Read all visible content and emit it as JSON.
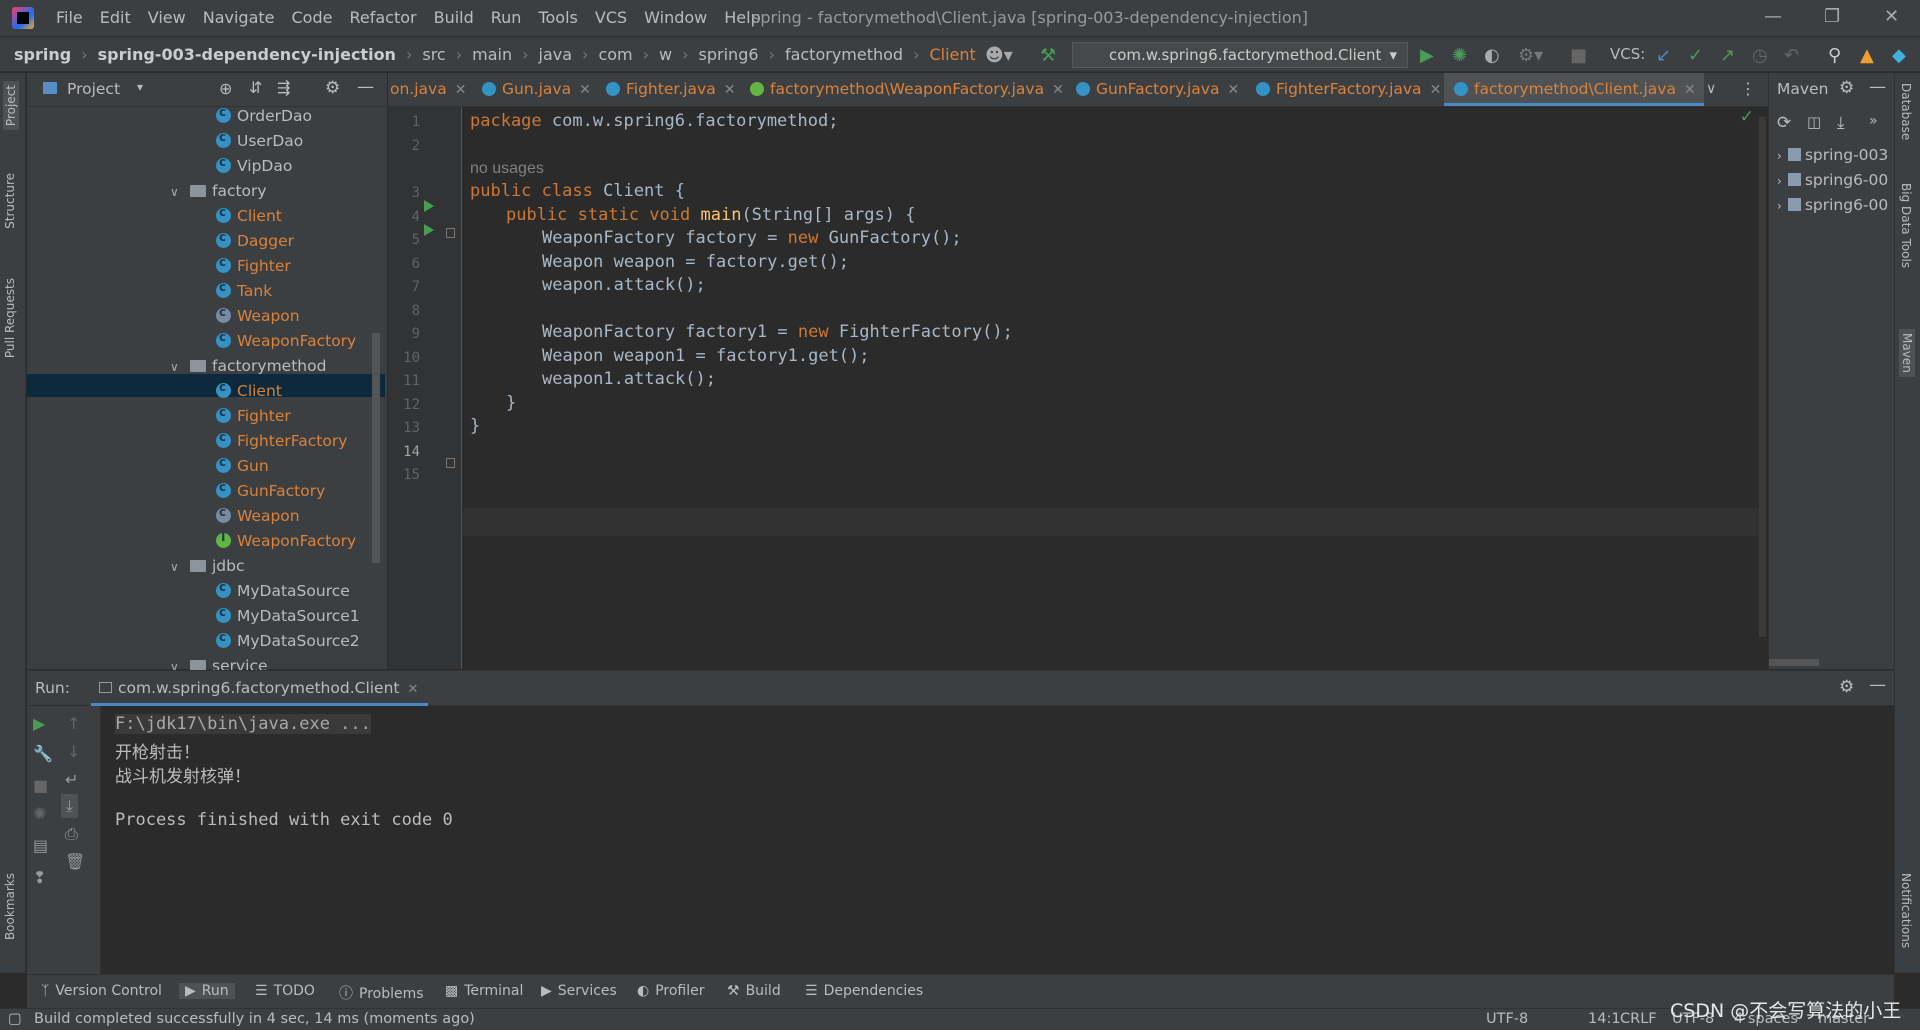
{
  "window": {
    "menu": [
      "File",
      "Edit",
      "View",
      "Navigate",
      "Code",
      "Refactor",
      "Build",
      "Run",
      "Tools",
      "VCS",
      "Window",
      "Help"
    ],
    "title": "spring - factorymethod\\Client.java [spring-003-dependency-injection]"
  },
  "breadcrumbs": [
    "spring",
    "spring-003-dependency-injection",
    "src",
    "main",
    "java",
    "com",
    "w",
    "spring6",
    "factorymethod",
    "Client"
  ],
  "toolbar": {
    "run_config": "com.w.spring6.factorymethod.Client",
    "vcs_label": "VCS:"
  },
  "left_strip": {
    "project": "Project",
    "structure": "Structure",
    "pull_requests": "Pull Requests",
    "bookmarks": "Bookmarks"
  },
  "right_strip": {
    "database": "Database",
    "bigdata": "Big Data Tools",
    "maven": "Maven",
    "notifications": "Notifications"
  },
  "project_panel": {
    "title": "Project",
    "tree": [
      {
        "label": "OrderDao",
        "kind": "class",
        "color": "plain"
      },
      {
        "label": "UserDao",
        "kind": "class",
        "color": "plain"
      },
      {
        "label": "VipDao",
        "kind": "class",
        "color": "plain"
      },
      {
        "label": "factory",
        "kind": "folder",
        "color": "plain"
      },
      {
        "label": "Client",
        "kind": "class",
        "color": "orange"
      },
      {
        "label": "Dagger",
        "kind": "class",
        "color": "orange"
      },
      {
        "label": "Fighter",
        "kind": "class",
        "color": "orange"
      },
      {
        "label": "Tank",
        "kind": "class",
        "color": "orange"
      },
      {
        "label": "Weapon",
        "kind": "abstract",
        "color": "orange"
      },
      {
        "label": "WeaponFactory",
        "kind": "class",
        "color": "orange"
      },
      {
        "label": "factorymethod",
        "kind": "folder",
        "color": "plain"
      },
      {
        "label": "Client",
        "kind": "class",
        "color": "orange"
      },
      {
        "label": "Fighter",
        "kind": "class",
        "color": "orange"
      },
      {
        "label": "FighterFactory",
        "kind": "class",
        "color": "orange"
      },
      {
        "label": "Gun",
        "kind": "class",
        "color": "orange"
      },
      {
        "label": "GunFactory",
        "kind": "class",
        "color": "orange"
      },
      {
        "label": "Weapon",
        "kind": "abstract",
        "color": "orange"
      },
      {
        "label": "WeaponFactory",
        "kind": "interface",
        "color": "orange"
      },
      {
        "label": "jdbc",
        "kind": "folder",
        "color": "plain"
      },
      {
        "label": "MyDataSource",
        "kind": "class",
        "color": "plain"
      },
      {
        "label": "MyDataSource1",
        "kind": "class",
        "color": "plain"
      },
      {
        "label": "MyDataSource2",
        "kind": "class",
        "color": "plain"
      },
      {
        "label": "service",
        "kind": "folder",
        "color": "plain"
      }
    ]
  },
  "editor_tabs": [
    {
      "label": "on.java"
    },
    {
      "label": "Gun.java"
    },
    {
      "label": "Fighter.java"
    },
    {
      "label": "factorymethod\\WeaponFactory.java"
    },
    {
      "label": "GunFactory.java"
    },
    {
      "label": "FighterFactory.java"
    },
    {
      "label": "factorymethod\\Client.java"
    }
  ],
  "editor": {
    "line_numbers": [
      "1",
      "2",
      "3",
      "4",
      "5",
      "6",
      "7",
      "8",
      "9",
      "10",
      "11",
      "12",
      "13",
      "14",
      "15"
    ],
    "usage_hint": "no usages",
    "code": {
      "l1_kw": "package",
      "l1_rest": " com.w.spring6.factorymethod;",
      "l3_kw": "public class",
      "l3_rest": " Client {",
      "l4_kw": "public static void",
      "l4_fn": "main",
      "l4_rest": "(String[] args) {",
      "l5_a": "WeaponFactory factory = ",
      "l5_kw": "new",
      "l5_b": " GunFactory();",
      "l6": "Weapon weapon = factory.get();",
      "l7": "weapon.attack();",
      "l9_a": "WeaponFactory factory1 = ",
      "l9_kw": "new",
      "l9_b": " FighterFactory();",
      "l10": "Weapon weapon1 = factory1.get();",
      "l11": "weapon1.attack();",
      "l12": "}",
      "l13": "}"
    }
  },
  "maven": {
    "title": "Maven",
    "items": [
      "spring-003",
      "spring6-00",
      "spring6-00"
    ]
  },
  "run_panel": {
    "label": "Run:",
    "tab": "com.w.spring6.factorymethod.Client",
    "output": [
      "F:\\jdk17\\bin\\java.exe ...",
      "开枪射击！",
      "战斗机发射核弹！",
      "",
      "Process finished with exit code 0"
    ]
  },
  "bottom_tabs": [
    "Version Control",
    "Run",
    "TODO",
    "Problems",
    "Terminal",
    "Services",
    "Profiler",
    "Build",
    "Dependencies"
  ],
  "status": {
    "message": "Build completed successfully in 4 sec, 14 ms (moments ago)",
    "encoding": "UTF-8",
    "position": "14:1",
    "line_sep": "CRLF",
    "encoding2": "UTF-8",
    "indent": "4 spaces",
    "branch": "master"
  },
  "watermark": "CSDN @不会写算法的小王"
}
